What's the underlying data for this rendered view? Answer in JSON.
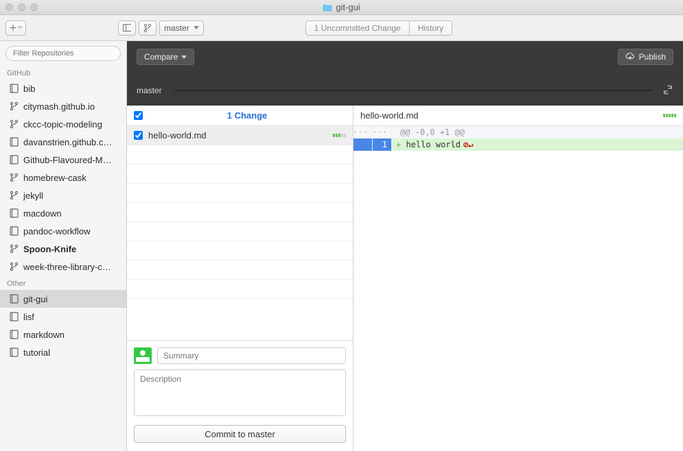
{
  "window": {
    "title": "git-gui"
  },
  "toolbar": {
    "branch_label": "master",
    "segment_left": "1 Uncommitted Change",
    "segment_right": "History"
  },
  "sidebar": {
    "filter_placeholder": "Filter Repositories",
    "groups": [
      {
        "name": "GitHub",
        "repos": [
          {
            "label": "bib",
            "kind": "repo"
          },
          {
            "label": "citymash.github.io",
            "kind": "fork"
          },
          {
            "label": "ckcc-topic-modeling",
            "kind": "fork"
          },
          {
            "label": "davanstrien.github.c…",
            "kind": "repo"
          },
          {
            "label": "Github-Flavoured-M…",
            "kind": "repo"
          },
          {
            "label": "homebrew-cask",
            "kind": "fork"
          },
          {
            "label": "jekyll",
            "kind": "fork"
          },
          {
            "label": "macdown",
            "kind": "repo"
          },
          {
            "label": "pandoc-workflow",
            "kind": "repo"
          },
          {
            "label": "Spoon-Knife",
            "kind": "fork",
            "bold": true
          },
          {
            "label": "week-three-library-c…",
            "kind": "fork"
          }
        ]
      },
      {
        "name": "Other",
        "repos": [
          {
            "label": "git-gui",
            "kind": "repo",
            "selected": true
          },
          {
            "label": "lisf",
            "kind": "repo"
          },
          {
            "label": "markdown",
            "kind": "repo"
          },
          {
            "label": "tutorial",
            "kind": "repo"
          }
        ]
      }
    ]
  },
  "header": {
    "compare": "Compare",
    "publish": "Publish",
    "branch": "master"
  },
  "changes": {
    "count_label": "1 Change",
    "items": [
      {
        "file": "hello-world.md",
        "checked": true
      }
    ]
  },
  "commit": {
    "summary_placeholder": "Summary",
    "description_placeholder": "Description",
    "button": "Commit to master"
  },
  "diff": {
    "file": "hello-world.md",
    "hunk": "@@ -0,0 +1 @@",
    "lines": [
      {
        "new": "1",
        "prefix": "+",
        "text": "hello world",
        "type": "add",
        "eol": true
      }
    ]
  }
}
